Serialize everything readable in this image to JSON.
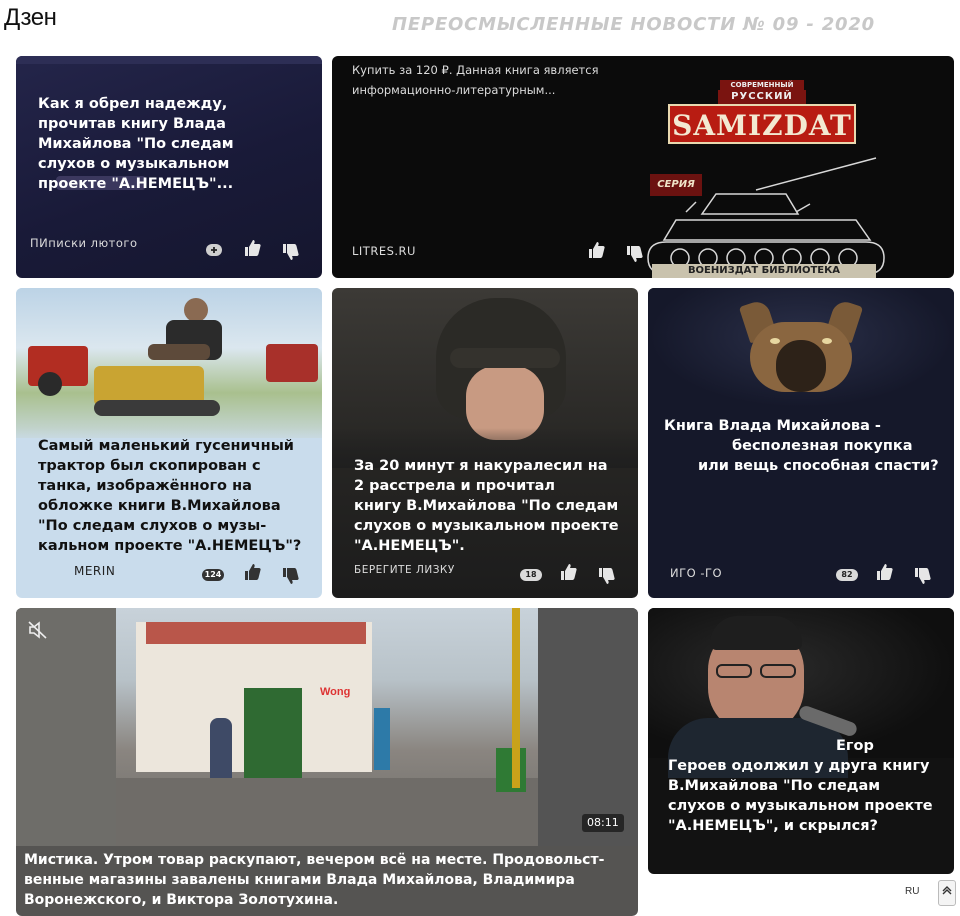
{
  "header": {
    "brand": "Дзен",
    "issue_title": "ПЕРЕОСМЫСЛЕННЫЕ НОВОСТИ № 09 - 2020"
  },
  "cards": [
    {
      "title_lines": [
        "Как я обрел надежду,",
        "прочитав книгу Влада",
        "Михайлова \"По следам",
        "слухов о музыкальном",
        "проекте \"А.НЕМЕЦЪ\"..."
      ],
      "source": "ПИписки лютого"
    },
    {
      "ad_lines": [
        "Купить за 120 ₽. Данная книга является",
        "информационно-литературным..."
      ],
      "source": "LITRES.RU",
      "cover_series": "СОВРЕМЕННЫЙ",
      "cover_series2": "РУССКИЙ",
      "cover_title": "SAMIZDAT",
      "cover_label": "СЕРИЯ",
      "cover_bottom": "ВОЕНИЗДАТ БИБЛИОТЕКА"
    },
    {
      "title_lines": [
        "Самый маленький гусеничный",
        "трактор был скопирован с",
        "танка, изображённого на",
        "обложке книги В.Михайлова",
        "\"По следам слухов о музы-",
        "кальном проекте \"А.НЕМЕЦЪ\"?"
      ],
      "source": "MERIN",
      "comments": "124"
    },
    {
      "title_lines": [
        "За 20 минут я накуралесил на",
        "2 расстрела и  прочитал",
        "книгу В.Михайлова \"По следам",
        "слухов о музыкальном проекте",
        "\"А.НЕМЕЦЪ\"."
      ],
      "source": "БЕРЕГИТЕ  ЛИЗКУ",
      "comments": "18"
    },
    {
      "title_lines": [
        "Книга Влада Михайлова -",
        "бесполезная покупка",
        "или вещь способная спасти?"
      ],
      "source": "ИГО -ГО",
      "comments": "82"
    },
    {
      "title_lines": [
        "Мистика. Утром товар раскупают, вечером всё на месте. Продовольст-",
        "венные магазины завалены книгами Влада Михайлова, Владимира",
        "Воронежского, и Виктора Золотухина."
      ],
      "duration": "08:11",
      "shop_sign": "Wong"
    },
    {
      "title_lines": [
        "Егор",
        "Героев одолжил у друга книгу",
        "В.Михайлова \"По следам",
        "слухов о музыкальном проекте",
        "\"А.НЕМЕЦЪ\", и скрылся?"
      ]
    }
  ],
  "footer": {
    "lang": "RU",
    "scroll_icon": "chevron-up-icon"
  },
  "icons": {
    "like": "thumbs-up-icon",
    "dislike": "thumbs-down-icon",
    "add": "plus-icon",
    "mute": "mute-icon"
  }
}
